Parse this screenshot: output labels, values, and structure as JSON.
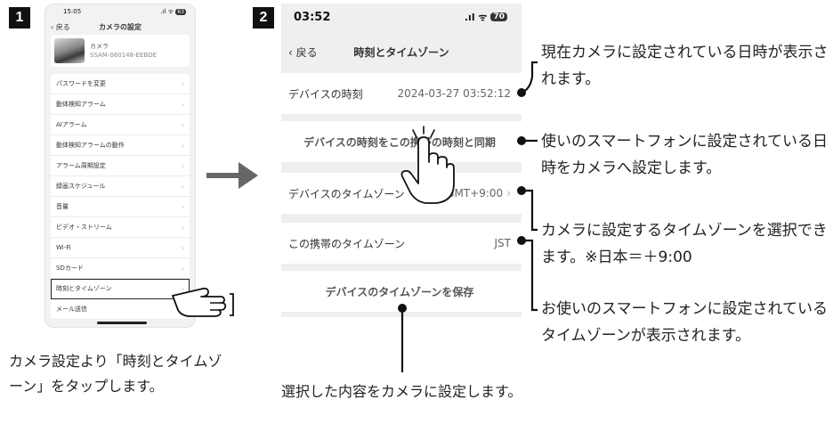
{
  "step_badges": [
    "1",
    "2"
  ],
  "phone1": {
    "status_time": "15:05",
    "status_icons": ".ıl ᯤ",
    "battery": "63",
    "back_label": "戻る",
    "title": "カメラの設定",
    "camera_label": "カメラ",
    "camera_id": "SSAM-060148-EEBDE",
    "menu_items": [
      "パスワードを変更",
      "動体検知アラーム",
      "AIアラーム",
      "動体検知アラームの動作",
      "アラーム周期設定",
      "録画スケジュール",
      "音量",
      "ビデオ・ストリーム",
      "Wi-Fi",
      "SDカード",
      "時刻とタイムゾーン",
      "メール送信"
    ],
    "highlighted_index": 10
  },
  "caption1": "カメラ設定より「時刻とタイムゾーン」をタップします。",
  "phone2": {
    "status_time": "03:52",
    "status_icons": ".ıl ᯤ",
    "battery": "70",
    "back_label": "戻る",
    "title": "時刻とタイムゾーン",
    "device_time_label": "デバイスの時刻",
    "device_time_value": "2024-03-27  03:52:12",
    "sync_button": "デバイスの時刻をこの携帯の時刻と同期",
    "device_timezone_label": "デバイスのタイムゾーン",
    "device_timezone_value": "GMT+9:00",
    "phone_timezone_label": "この携帯のタイムゾーン",
    "phone_timezone_value": "JST",
    "save_button": "デバイスのタイムゾーンを保存"
  },
  "notes": {
    "current_time": "現在カメラに設定されている日時が表示されます。",
    "sync": "使いのスマートフォンに設定されている日時をカメラへ設定します。",
    "timezone": "カメラに設定するタイムゾーンを選択できます。※日本＝＋9:00",
    "phone_timezone": "お使いのスマートフォンに設定されているタイムゾーンが表示されます。",
    "save": "選択した内容をカメラに設定します。"
  }
}
